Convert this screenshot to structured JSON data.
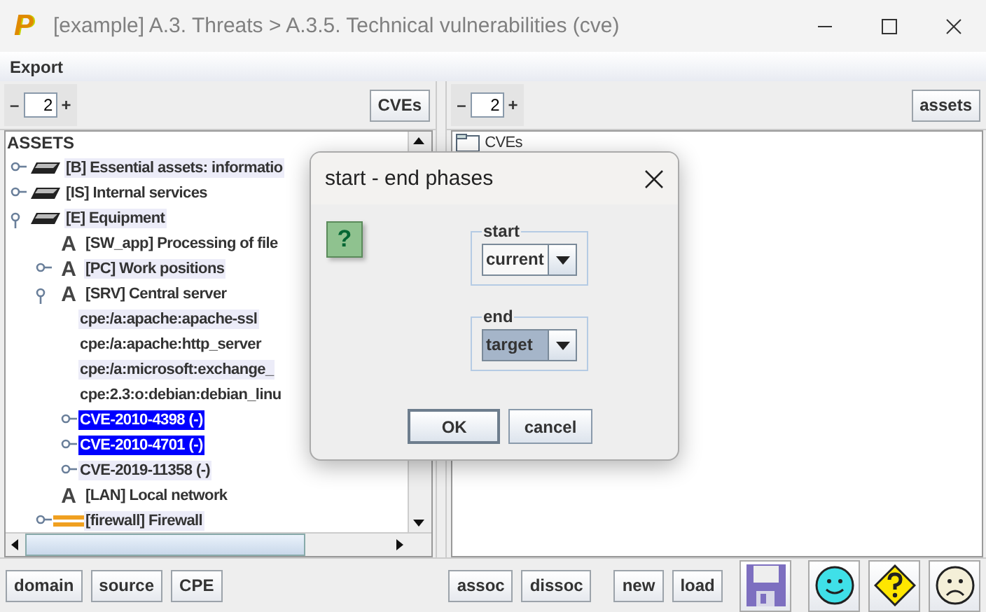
{
  "window": {
    "logo": "P",
    "title": "[example] A.3. Threats > A.3.5. Technical vulnerabilities (cve)"
  },
  "menu": [
    "Export"
  ],
  "left_pane": {
    "counter": {
      "minus": "–",
      "value": "2",
      "plus": "+"
    },
    "button": "CVEs",
    "root": "ASSETS",
    "tree": [
      {
        "label": "[B] Essential assets: informatio",
        "kind": "layer",
        "expanded": false,
        "highlighted": true,
        "selected": false
      },
      {
        "label": "[IS] Internal services",
        "kind": "layer",
        "expanded": false,
        "highlighted": false,
        "selected": false
      },
      {
        "label": "[E] Equipment",
        "kind": "layer",
        "expanded": true,
        "highlighted": true,
        "selected": false,
        "children": [
          {
            "label": "[SW_app] Processing of file",
            "kind": "letter",
            "icon_text": "A",
            "highlighted": false,
            "selected": false
          },
          {
            "label": "[PC] Work positions",
            "kind": "letter",
            "icon_text": "A",
            "expanded": false,
            "highlighted": true,
            "selected": false
          },
          {
            "label": "[SRV] Central server",
            "kind": "letter",
            "icon_text": "A",
            "expanded": true,
            "highlighted": false,
            "selected": false,
            "children": [
              {
                "label": "cpe:/a:apache:apache-ssl",
                "highlighted": true,
                "selected": false
              },
              {
                "label": "cpe:/a:apache:http_server",
                "highlighted": false,
                "selected": false
              },
              {
                "label": "cpe:/a:microsoft:exchange_",
                "highlighted": true,
                "selected": false
              },
              {
                "label": "cpe:2.3:o:debian:debian_linu",
                "highlighted": false,
                "selected": false
              },
              {
                "label": "CVE-2010-4398 (-)",
                "expanded": false,
                "highlighted": false,
                "selected": true
              },
              {
                "label": "CVE-2010-4701 (-)",
                "expanded": false,
                "highlighted": false,
                "selected": true
              },
              {
                "label": "CVE-2019-11358 (-)",
                "expanded": false,
                "highlighted": true,
                "selected": false
              }
            ]
          },
          {
            "label": "[LAN] Local network",
            "kind": "letter",
            "icon_text": "A",
            "highlighted": false,
            "selected": false
          },
          {
            "label": "[firewall] Firewall",
            "kind": "firewall",
            "expanded": false,
            "highlighted": true,
            "selected": false
          }
        ]
      }
    ]
  },
  "right_pane": {
    "counter": {
      "minus": "–",
      "value": "2",
      "plus": "+"
    },
    "button": "assets",
    "tree": [
      {
        "label": "CVEs",
        "kind": "folder"
      }
    ]
  },
  "bottom_buttons": [
    "domain",
    "source",
    "CPE",
    "assoc",
    "dissoc",
    "new",
    "load"
  ],
  "dialog": {
    "title": "start - end phases",
    "icon_text": "?",
    "groups": [
      {
        "legend": "start",
        "value": "current",
        "focused": false
      },
      {
        "legend": "end",
        "value": "target",
        "focused": true
      }
    ],
    "buttons": [
      {
        "label": "OK",
        "default": true
      },
      {
        "label": "cancel",
        "default": false
      }
    ]
  }
}
